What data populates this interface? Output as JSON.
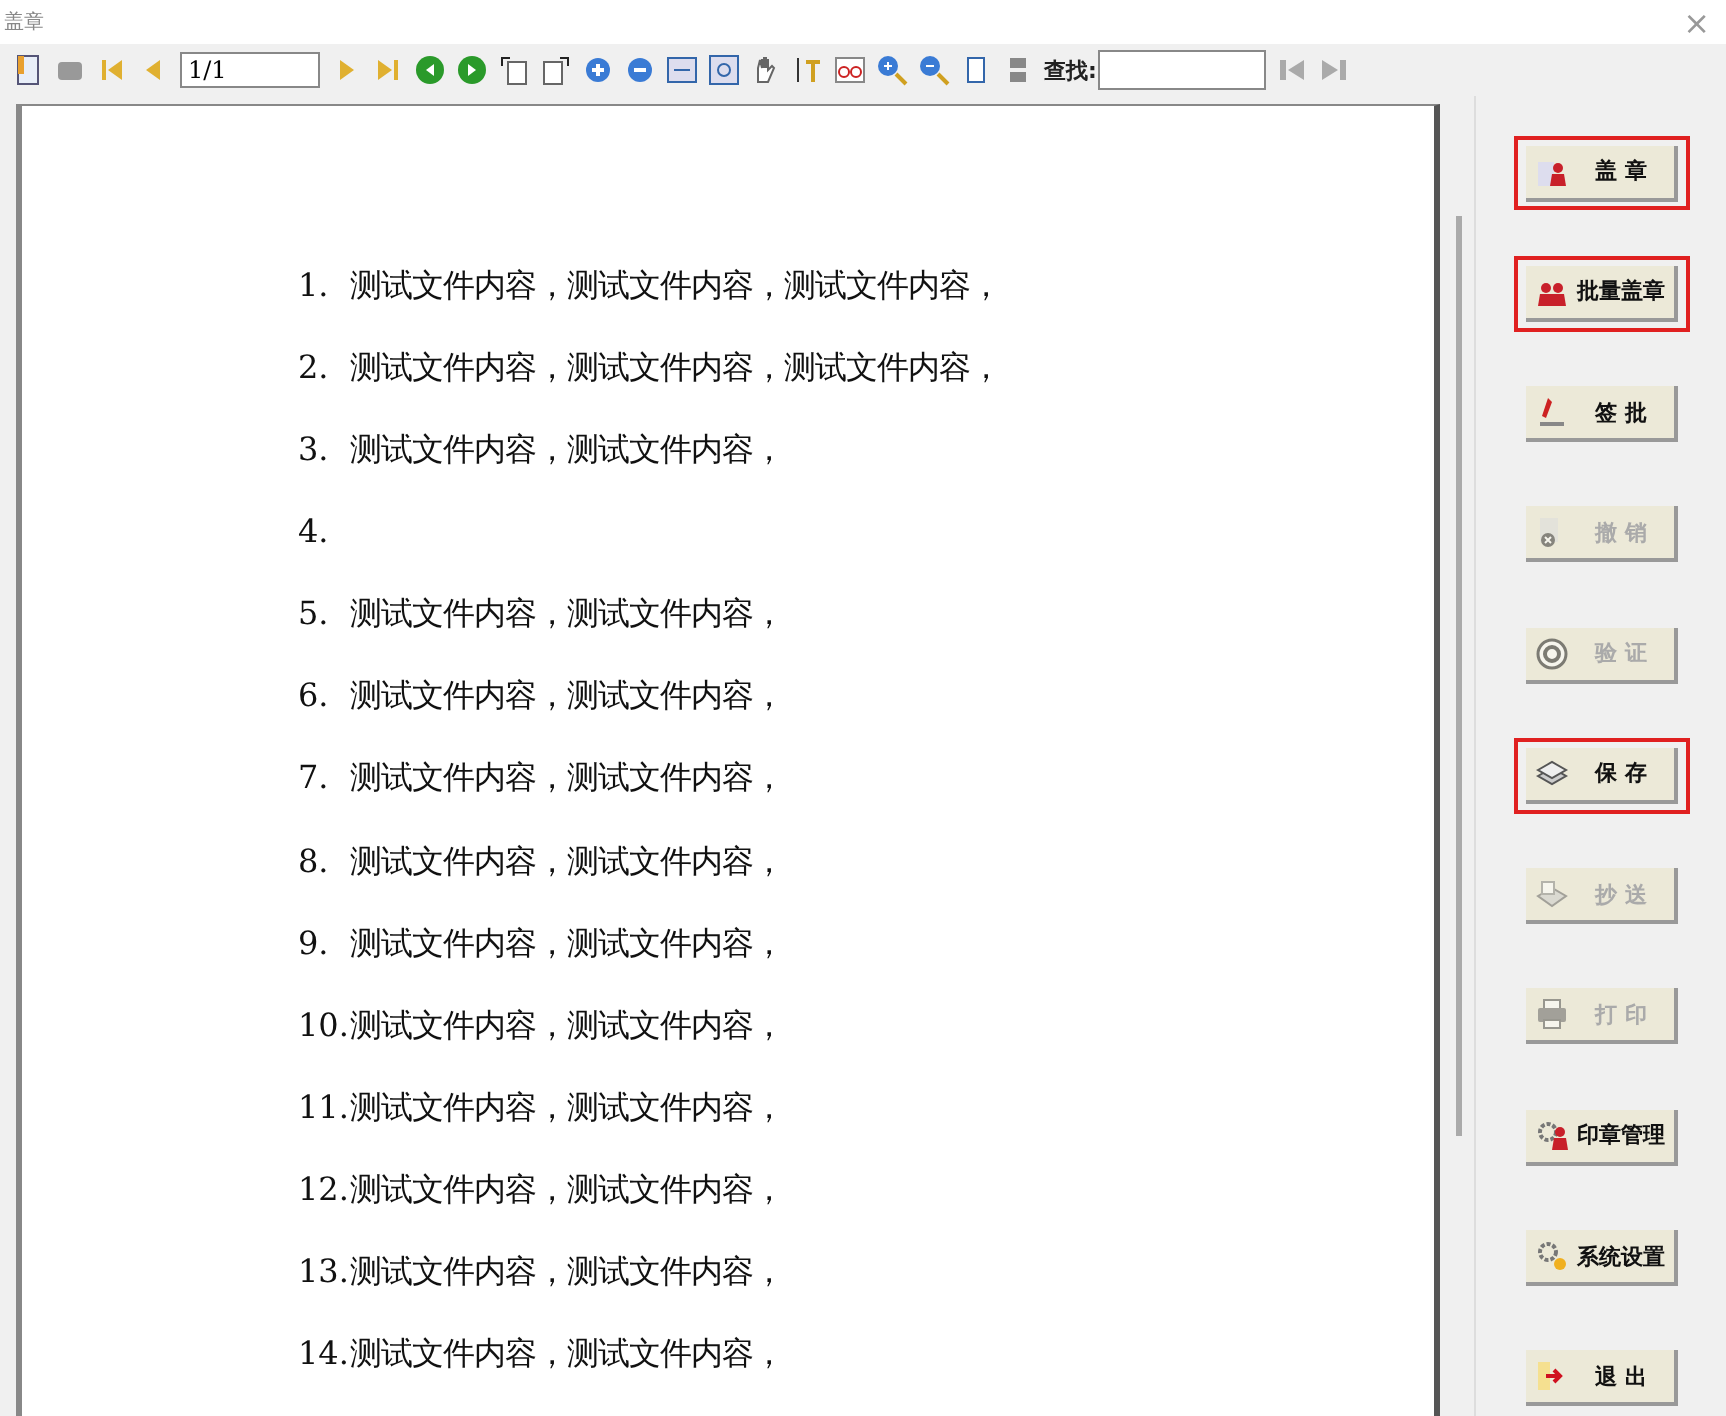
{
  "window": {
    "title": "盖章",
    "close": "×"
  },
  "toolbar": {
    "page": "1/1",
    "search_label": "查找:"
  },
  "document": {
    "lines": [
      {
        "number": "1.",
        "text": "测试文件内容，测试文件内容，测试文件内容，"
      },
      {
        "number": "2.",
        "text": "测试文件内容，测试文件内容，测试文件内容，"
      },
      {
        "number": "3.",
        "text": "测试文件内容，测试文件内容，"
      },
      {
        "number": "4."
      },
      {
        "number": "5.",
        "text": "测试文件内容，测试文件内容，"
      },
      {
        "number": "6.",
        "text": "测试文件内容，测试文件内容，"
      },
      {
        "number": "7.",
        "text": "测试文件内容，测试文件内容，"
      },
      {
        "number": "8.",
        "text": "测试文件内容，测试文件内容，"
      },
      {
        "number": "9.",
        "text": "测试文件内容，测试文件内容，"
      },
      {
        "number": "10.",
        "text": "测试文件内容，测试文件内容，"
      },
      {
        "number": "11.",
        "text": "测试文件内容，测试文件内容，"
      },
      {
        "number": "12.",
        "text": "测试文件内容，测试文件内容，"
      },
      {
        "number": "13.",
        "text": "测试文件内容，测试文件内容，"
      },
      {
        "number": "14.",
        "text": "测试文件内容，测试文件内容，"
      }
    ]
  },
  "actions": [
    {
      "label": "盖 章",
      "kind": "seal",
      "disabled": false,
      "highlighted": true
    },
    {
      "label": "批量盖章",
      "kind": "batch",
      "disabled": false,
      "highlighted": true
    },
    {
      "label": "签 批",
      "kind": "sign",
      "disabled": false,
      "highlighted": false
    },
    {
      "label": "撤 销",
      "kind": "revoke",
      "disabled": true,
      "highlighted": false
    },
    {
      "label": "验 证",
      "kind": "verify",
      "disabled": true,
      "highlighted": false
    },
    {
      "label": "保 存",
      "kind": "save",
      "disabled": false,
      "highlighted": true
    },
    {
      "label": "抄 送",
      "kind": "send",
      "disabled": true,
      "highlighted": false
    },
    {
      "label": "打 印",
      "kind": "print",
      "disabled": true,
      "highlighted": false
    },
    {
      "label": "印章管理",
      "kind": "manage",
      "disabled": false,
      "highlighted": false
    },
    {
      "label": "系统设置",
      "kind": "settings",
      "disabled": false,
      "highlighted": false
    },
    {
      "label": "退 出",
      "kind": "exit",
      "disabled": false,
      "highlighted": false
    }
  ]
}
